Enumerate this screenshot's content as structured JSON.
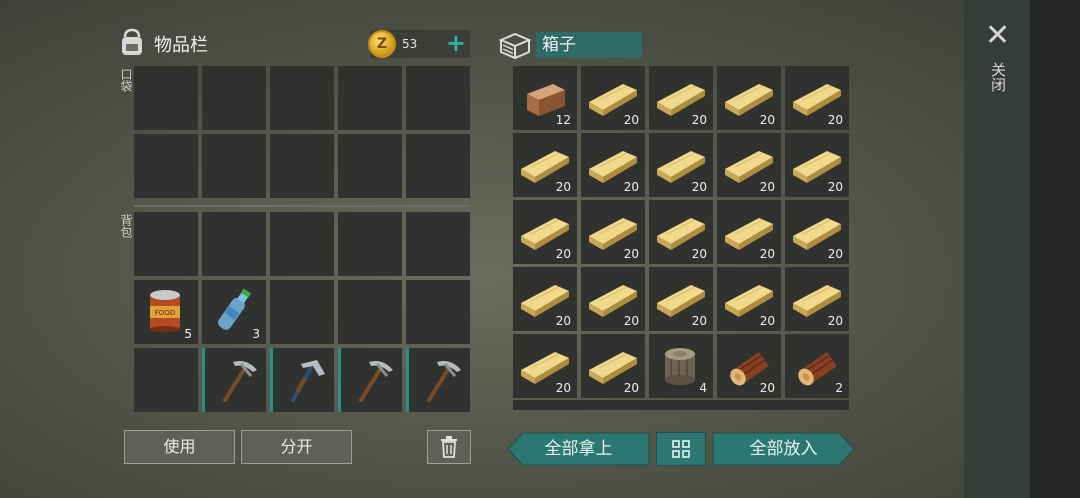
{
  "inventory": {
    "title": "物品栏",
    "coins": "53",
    "plus": "+",
    "pocket_label": "口袋",
    "backpack_label": "背包"
  },
  "box": {
    "title": "箱子"
  },
  "buttons": {
    "use": "使用",
    "split": "分开",
    "take_all": "全部拿上",
    "put_all": "全部放入",
    "close_symbol": "✕",
    "close": "关闭"
  },
  "pockets": [
    {
      "item": "",
      "count": ""
    },
    {
      "item": "",
      "count": ""
    },
    {
      "item": "",
      "count": ""
    },
    {
      "item": "",
      "count": ""
    },
    {
      "item": "",
      "count": ""
    },
    {
      "item": "",
      "count": ""
    },
    {
      "item": "",
      "count": ""
    },
    {
      "item": "",
      "count": ""
    },
    {
      "item": "",
      "count": ""
    },
    {
      "item": "",
      "count": ""
    }
  ],
  "backpack": [
    {
      "item": "",
      "count": ""
    },
    {
      "item": "",
      "count": ""
    },
    {
      "item": "",
      "count": ""
    },
    {
      "item": "",
      "count": ""
    },
    {
      "item": "",
      "count": ""
    },
    {
      "item": "canned-food",
      "count": "5"
    },
    {
      "item": "water-bottle",
      "count": "3"
    },
    {
      "item": "",
      "count": ""
    },
    {
      "item": "",
      "count": ""
    },
    {
      "item": "",
      "count": ""
    },
    {
      "item": "",
      "count": ""
    },
    {
      "item": "pickaxe",
      "count": "",
      "equip": true
    },
    {
      "item": "hammer-pickaxe",
      "count": "",
      "equip": true
    },
    {
      "item": "pickaxe",
      "count": "",
      "equip": true
    },
    {
      "item": "pickaxe",
      "count": "",
      "equip": true
    }
  ],
  "box_items": [
    {
      "item": "wood-block",
      "count": "12"
    },
    {
      "item": "plank",
      "count": "20"
    },
    {
      "item": "plank",
      "count": "20"
    },
    {
      "item": "plank",
      "count": "20"
    },
    {
      "item": "plank",
      "count": "20"
    },
    {
      "item": "plank",
      "count": "20"
    },
    {
      "item": "plank",
      "count": "20"
    },
    {
      "item": "plank",
      "count": "20"
    },
    {
      "item": "plank",
      "count": "20"
    },
    {
      "item": "plank",
      "count": "20"
    },
    {
      "item": "plank",
      "count": "20"
    },
    {
      "item": "plank",
      "count": "20"
    },
    {
      "item": "plank",
      "count": "20"
    },
    {
      "item": "plank",
      "count": "20"
    },
    {
      "item": "plank",
      "count": "20"
    },
    {
      "item": "plank",
      "count": "20"
    },
    {
      "item": "plank",
      "count": "20"
    },
    {
      "item": "plank",
      "count": "20"
    },
    {
      "item": "plank",
      "count": "20"
    },
    {
      "item": "plank",
      "count": "20"
    },
    {
      "item": "plank",
      "count": "20"
    },
    {
      "item": "plank",
      "count": "20"
    },
    {
      "item": "log-stump",
      "count": "4"
    },
    {
      "item": "log",
      "count": "20"
    },
    {
      "item": "log",
      "count": "2"
    }
  ]
}
